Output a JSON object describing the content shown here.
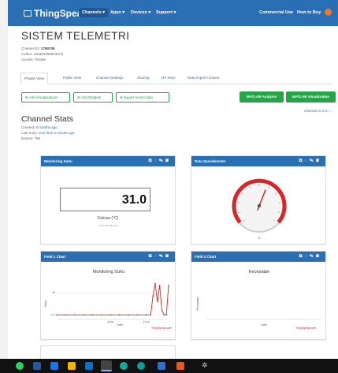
{
  "nav": {
    "brand": "ThingSpeak™",
    "items": [
      "Channels ▾",
      "Apps ▾",
      "Devices ▾",
      "Support ▾"
    ],
    "right_items": [
      "Commercial Use",
      "How to Buy"
    ],
    "accent": "#2a6fb3"
  },
  "channel": {
    "title": "SISTEM TELEMETRI",
    "id_label": "Channel ID:",
    "id_value": "1790705",
    "author_label": "Author:",
    "author_value": "mwa0000002307S",
    "access_label": "Access:",
    "access_value": "Private"
  },
  "tabs": [
    "Private View",
    "Public View",
    "Channel Settings",
    "Sharing",
    "API Keys",
    "Data Import / Export"
  ],
  "buttons": {
    "add_visualizations": "⊕ Add Visualizations",
    "add_widgets": "⊕ Add Widgets",
    "export_recent": "⊕ Export recent data",
    "matlab_analysis": "MATLAB Analysis",
    "matlab_visualization": "MATLAB Visualization"
  },
  "pager": "Channel 3 of 3  ‹  ›",
  "stats": {
    "title": "Channel Stats",
    "created_label": "Created:",
    "created_value": "6 months ago",
    "last_entry_label": "Last entry:",
    "last_entry_value": "less than a minute ago",
    "entries_label": "Entries:",
    "entries_value": "796"
  },
  "widgets": {
    "monitoring": {
      "title": "Monitoring Suhu",
      "value": "31.0",
      "unit": "Celcius (°C)",
      "ago": "a few seconds ago"
    },
    "speedometer": {
      "title": "Data Speedometer",
      "value": 0,
      "value_label": "0",
      "min": 0,
      "max": 100
    },
    "field1": {
      "title": "Field 1 Chart",
      "chart_title": "Monitoring Suhu"
    },
    "field2": {
      "title": "Field 2 Chart",
      "chart_title": "Kecepatan"
    }
  },
  "icons": [
    "external-link-icon",
    "comment-icon",
    "pencil-icon",
    "close-icon"
  ],
  "chart_data": [
    {
      "type": "line",
      "title": "Monitoring Suhu",
      "xlabel": "Date",
      "ylabel": "Suhu",
      "x_ticks": [
        "16:00",
        "17:00"
      ],
      "y_ticks": [
        27.5,
        40
      ],
      "ylim": [
        25,
        47
      ],
      "series": [
        {
          "x": [
            0,
            0.08,
            0.16,
            0.24,
            0.32,
            0.4,
            0.48,
            0.56,
            0.64,
            0.72,
            0.8,
            0.84,
            0.86,
            0.88,
            0.9,
            0.92,
            0.94,
            0.96,
            0.98,
            1.0
          ],
          "values": [
            27.5,
            27.5,
            27.5,
            27.5,
            27.5,
            27.5,
            27.5,
            27.5,
            27.5,
            27.5,
            27.5,
            27.5,
            38,
            45,
            35,
            44,
            30,
            27.5,
            27.5,
            44
          ]
        }
      ],
      "color": "#d62728",
      "credit": "ThingSpeak.com"
    },
    {
      "type": "line",
      "title": "Kecepatan",
      "xlabel": "Date",
      "ylabel": "Kecepatan",
      "series": [],
      "credit": "ThingSpeak.com"
    }
  ]
}
